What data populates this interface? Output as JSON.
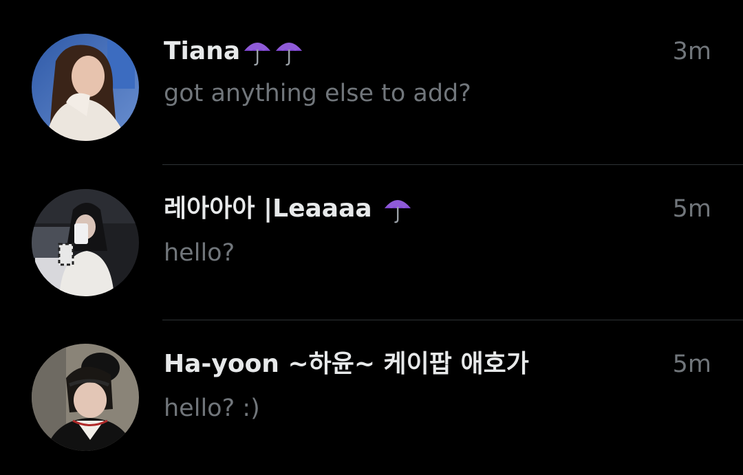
{
  "conversations": [
    {
      "display_name": "Tiana",
      "emojis": [
        "umbrella-icon",
        "umbrella-icon"
      ],
      "time": "3m",
      "preview": "got anything else to add?"
    },
    {
      "display_name": "레아아아 |Leaaaa",
      "emojis": [
        "umbrella-icon"
      ],
      "time": "5m",
      "preview": "hello?"
    },
    {
      "display_name": "Ha-yoon ~하윤~ 케이팝 애호가",
      "emojis": [],
      "time": "5m",
      "preview": "hello? :)"
    }
  ],
  "colors": {
    "background": "#000000",
    "name_text": "#e7e9ea",
    "secondary_text": "#71767b",
    "divider": "#2f3336",
    "umbrella": "#8f5bd8"
  }
}
